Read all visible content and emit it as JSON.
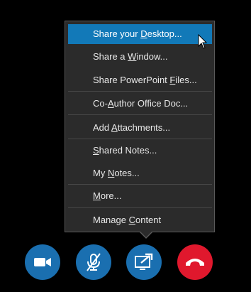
{
  "menu": {
    "items": [
      {
        "pre": "Share your ",
        "acc": "D",
        "post": "esktop..."
      },
      {
        "pre": "Share a ",
        "acc": "W",
        "post": "indow..."
      },
      {
        "pre": "Share PowerPoint ",
        "acc": "F",
        "post": "iles..."
      },
      {
        "pre": "Co-",
        "acc": "A",
        "post": "uthor Office Doc..."
      },
      {
        "pre": "Add ",
        "acc": "A",
        "post": "ttachments..."
      },
      {
        "pre": "",
        "acc": "S",
        "post": "hared Notes..."
      },
      {
        "pre": "My ",
        "acc": "N",
        "post": "otes..."
      },
      {
        "pre": "",
        "acc": "M",
        "post": "ore..."
      },
      {
        "pre": "Manage ",
        "acc": "C",
        "post": "ontent"
      }
    ]
  },
  "controls": {
    "video": {
      "color": "#1a6fb0",
      "icon": "video-camera-icon"
    },
    "mic": {
      "color": "#1a6fb0",
      "icon": "microphone-muted-icon"
    },
    "share": {
      "color": "#1a6fb0",
      "icon": "present-screen-icon"
    },
    "hangup": {
      "color": "#e0182d",
      "icon": "phone-hangup-icon"
    }
  }
}
